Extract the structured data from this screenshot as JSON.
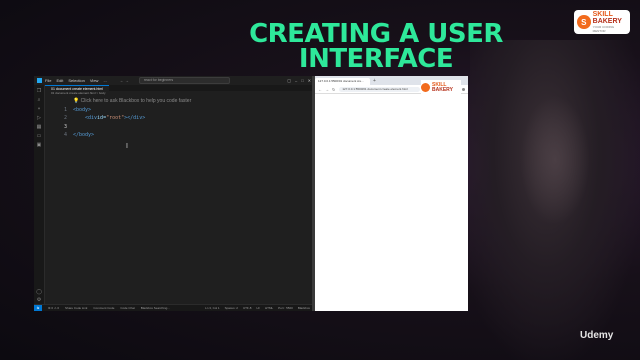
{
  "slide": {
    "headline_line1": "CREATING A USER",
    "headline_line2": "INTERFACE",
    "headline_color": "#2ee89a",
    "brand_line1": "SKILL",
    "brand_line2": "BAKERY",
    "brand_tagline": "YOUR CODING MENTOR",
    "watermark": "Udemy"
  },
  "vscode": {
    "menu": [
      "File",
      "Edit",
      "Selection",
      "View",
      "..."
    ],
    "search_placeholder": "react for beginners",
    "tab_label": "01 document create element.html",
    "breadcrumb": "01 document create element.html > body",
    "code_lines": [
      {
        "n": "1",
        "open": "<body>"
      },
      {
        "n": "2",
        "tag_open": "<div ",
        "attr": "id=",
        "value": "\"root\"",
        "tag_close": "></div>"
      },
      {
        "n": "3",
        "text": ""
      },
      {
        "n": "4",
        "close": "</body>"
      }
    ],
    "hint_text": "Click here to ask Blackbox to help you code faster",
    "status": {
      "left_items": [
        "⊗ 0 ⚠ 0",
        "Share Code Link",
        "Comment Code",
        "Code Chat",
        "Blackbox Searching..."
      ],
      "right_items": [
        "Ln 3, Col 1",
        "Spaces: 2",
        "UTF-8",
        "LF",
        "HTML",
        "Port : 5500",
        "Blackbox"
      ]
    }
  },
  "browser": {
    "tab_label": "127.0.0.1:5500/01 document cre...",
    "new_tab": "+",
    "url": "127.0.0.1:5500/01 document create element.html",
    "brand_line1": "SKILL",
    "brand_line2": "BAKERY"
  }
}
